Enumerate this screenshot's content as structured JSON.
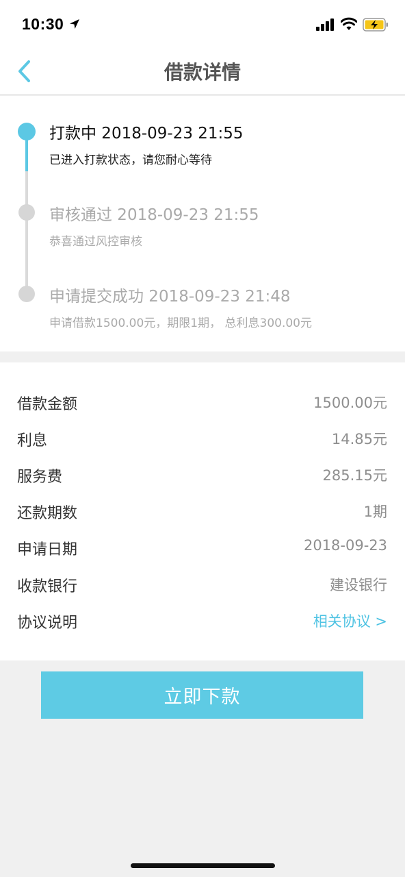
{
  "status_bar": {
    "time": "10:30",
    "icons": [
      "location-arrow-icon",
      "cellular-signal-icon",
      "wifi-icon",
      "battery-charging-icon"
    ]
  },
  "nav": {
    "title": "借款详情",
    "back_icon": "chevron-left-icon"
  },
  "colors": {
    "accent": "#5cc8e4",
    "inactive": "#d6d6d6",
    "background": "#f0f0f0",
    "link": "#4fc3e3"
  },
  "timeline": [
    {
      "title": "打款中 2018-09-23 21:55",
      "subtitle": "已进入打款状态，请您耐心等待",
      "active": true
    },
    {
      "title": "审核通过 2018-09-23 21:55",
      "subtitle": "恭喜通过风控审核",
      "active": false
    },
    {
      "title": "申请提交成功 2018-09-23 21:48",
      "subtitle": "申请借款1500.00元，期限1期， 总利息300.00元",
      "active": false
    }
  ],
  "details": [
    {
      "label": "借款金额",
      "value": "1500.00元"
    },
    {
      "label": "利息",
      "value": "14.85元"
    },
    {
      "label": "服务费",
      "value": "285.15元"
    },
    {
      "label": "还款期数",
      "value": "1期"
    },
    {
      "label": "申请日期",
      "value": "2018-09-23"
    },
    {
      "label": "收款银行",
      "value": "建设银行"
    },
    {
      "label": "协议说明",
      "value": "相关协议 >",
      "link": true
    }
  ],
  "actions": {
    "primary_label": "立即下款"
  }
}
